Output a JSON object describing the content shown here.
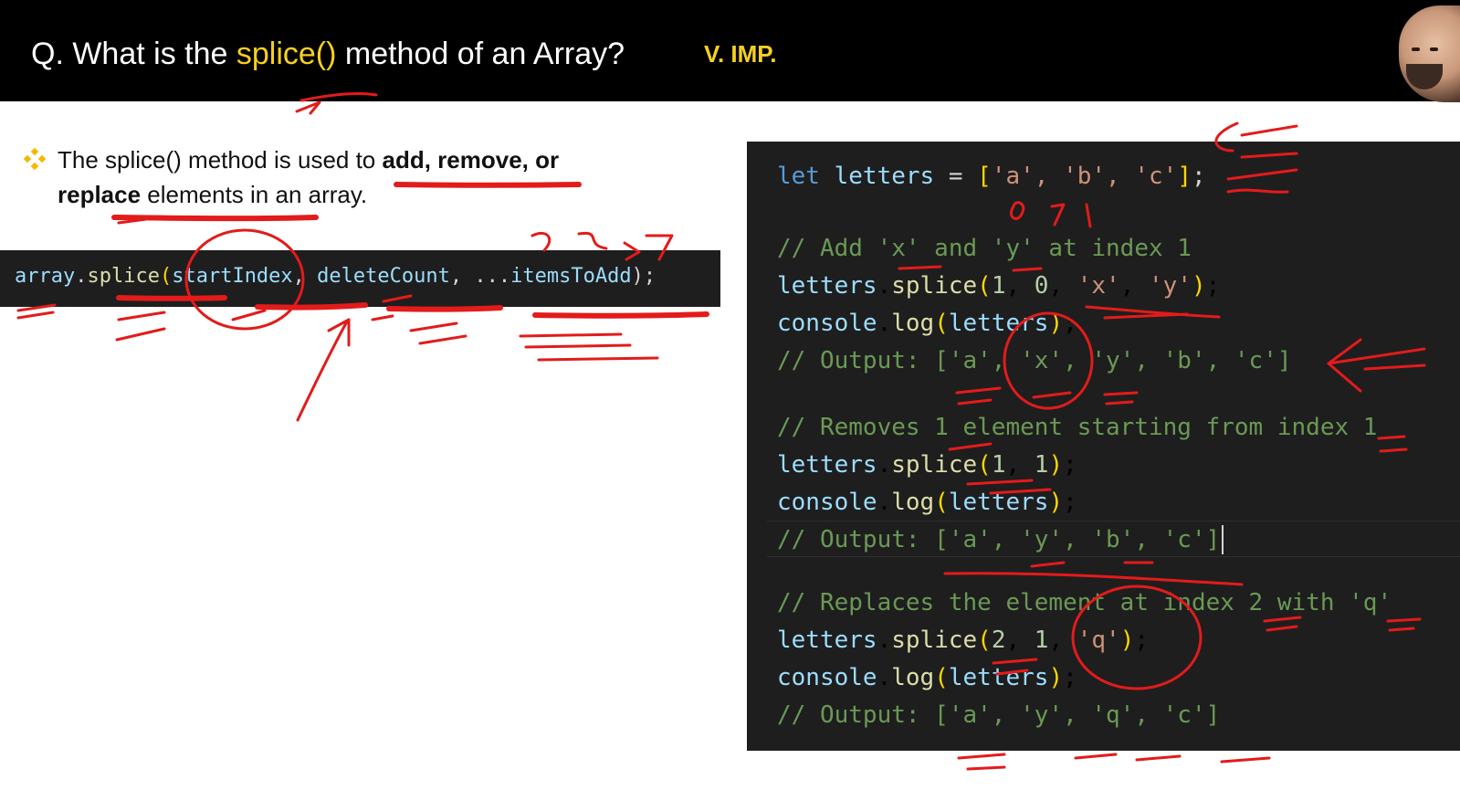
{
  "slide": {
    "title_prefix": "Q. What is the ",
    "title_highlight": "splice()",
    "title_suffix": " method of an Array?",
    "badge": "V. IMP."
  },
  "bullet": {
    "icon": "diamond-bullet-icon",
    "text_1": "The splice() method is used to ",
    "bold_1": "add, remove, or",
    "bold_2": "replace",
    "text_2": " elements in an array."
  },
  "syntax": {
    "obj": "array",
    "dot": ".",
    "fn": "splice",
    "open": "(",
    "p1": "startIndex",
    "sep1": ", ",
    "p2": "deleteCount",
    "sep2": ", ",
    "spread": "...",
    "p3": "itemsToAdd",
    "close": ");"
  },
  "editor": {
    "l1": {
      "kw": "let",
      "var": "letters",
      "eq": " = ",
      "open": "[",
      "items": "'a', 'b', 'c'",
      "close": "]",
      "end": ";"
    },
    "c1": "// Add 'x' and 'y' at index 1",
    "l2": {
      "obj": "letters",
      "fn": "splice",
      "n1": "1",
      "n2": "0",
      "s1": "'x'",
      "s2": "'y'"
    },
    "l3": {
      "obj": "console",
      "fn": "log",
      "arg": "letters"
    },
    "o1": "// Output: ['a', 'x', 'y', 'b', 'c']",
    "c2": "// Removes 1 element starting from index 1",
    "l4": {
      "obj": "letters",
      "fn": "splice",
      "n1": "1",
      "n2": "1"
    },
    "l5": {
      "obj": "console",
      "fn": "log",
      "arg": "letters"
    },
    "o2": "// Output: ['a', 'y', 'b', 'c']",
    "c3": "// Replaces the element at index 2 with 'q'",
    "l6": {
      "obj": "letters",
      "fn": "splice",
      "n1": "2",
      "n2": "1",
      "s1": "'q'"
    },
    "l7": {
      "obj": "console",
      "fn": "log",
      "arg": "letters"
    },
    "o3": "// Output: ['a', 'y', 'q', 'c']"
  },
  "annotations": {
    "index_digits": "0 1 2",
    "color": "#e31b1b"
  }
}
